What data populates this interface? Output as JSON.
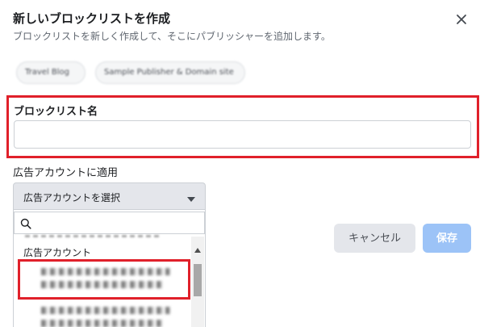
{
  "dialog": {
    "title": "新しいブロックリストを作成",
    "subtitle": "ブロックリストを新しく作成して、そこにパブリッシャーを追加します。",
    "close_icon": "close-icon"
  },
  "chips": [
    {
      "label": "Travel Blog"
    },
    {
      "label": "Sample Publisher & Domain site"
    }
  ],
  "blocklist_name": {
    "label": "ブロックリスト名",
    "value": "",
    "placeholder": ""
  },
  "ad_accounts": {
    "label": "広告アカウントに適用",
    "select_label": "広告アカウントを選択",
    "caret_icon": "caret-down-icon",
    "search_icon": "search-icon",
    "search_value": "",
    "section_label": "広告アカウント",
    "options": [
      {
        "name": "",
        "id": ""
      },
      {
        "name": "",
        "id": ""
      }
    ]
  },
  "buttons": {
    "cancel": "キャンセル",
    "save": "保存"
  },
  "colors": {
    "highlight": "#e0202a",
    "save_disabled": "#9cc3f7",
    "neutral_button": "#e4e6eb"
  }
}
